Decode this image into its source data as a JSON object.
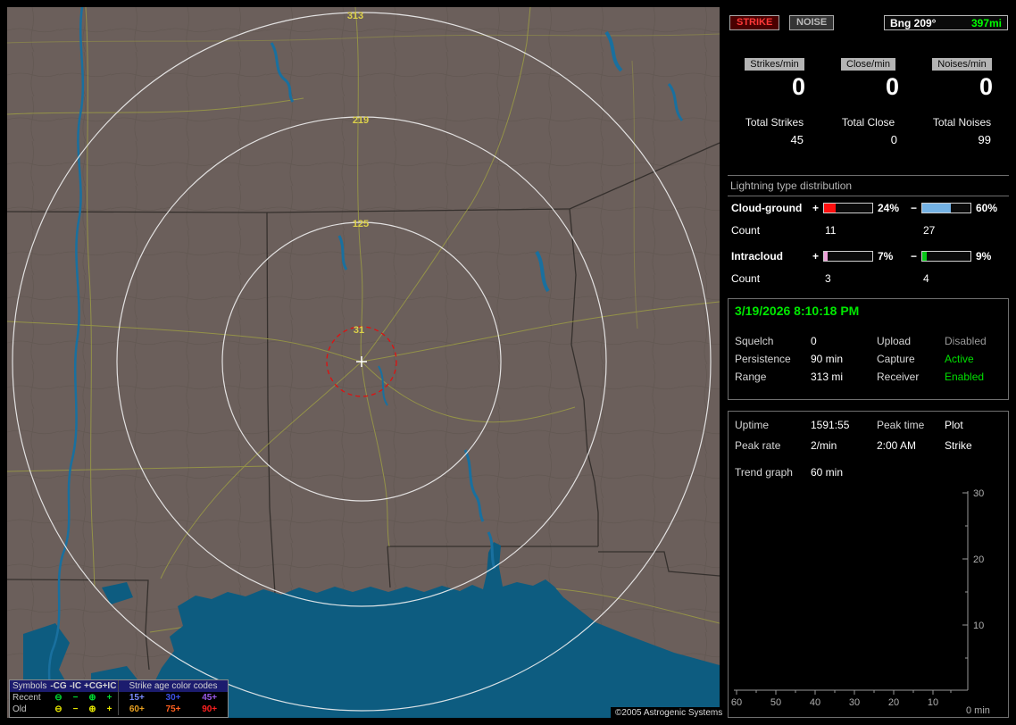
{
  "map": {
    "ring_labels": [
      "313",
      "219",
      "125",
      "31"
    ],
    "copyright": "©2005 Astrogenic Systems",
    "colors": {
      "land": "#6b5f5b",
      "water": "#0d5c80",
      "range_ring": "#f0f0f0",
      "ring_label": "#ddd24a",
      "alarm_ring": "#e01010",
      "road": "#9b9b45"
    },
    "legend": {
      "symbols_header": "Symbols",
      "type_headers": [
        "-CG",
        "-IC",
        "+CG",
        "+IC"
      ],
      "age_header": "Strike age color codes",
      "rows": [
        {
          "label": "Recent",
          "symbols": [
            "⊖",
            "−",
            "⊕",
            "+"
          ],
          "symbol_color": "#00dc32",
          "ages": [
            "15+",
            "30+",
            "45+"
          ],
          "age_colors": [
            "#7a8cff",
            "#3c50e8",
            "#9a5ae8"
          ]
        },
        {
          "label": "Old",
          "symbols": [
            "⊖",
            "−",
            "⊕",
            "+"
          ],
          "symbol_color": "#e8e800",
          "ages": [
            "60+",
            "75+",
            "90+"
          ],
          "age_colors": [
            "#e8a020",
            "#ff6020",
            "#ff2020"
          ]
        }
      ]
    }
  },
  "sidebar": {
    "header": {
      "strike": "STRIKE",
      "noise": "NOISE",
      "bearing": "Bng 209°",
      "distance": "397mi",
      "distance_color": "#00ff00"
    },
    "rates": [
      {
        "label": "Strikes/min",
        "value": "0"
      },
      {
        "label": "Close/min",
        "value": "0"
      },
      {
        "label": "Noises/min",
        "value": "0"
      }
    ],
    "totals": [
      {
        "label": "Total Strikes",
        "value": "45"
      },
      {
        "label": "Total Close",
        "value": "0"
      },
      {
        "label": "Total Noises",
        "value": "99"
      }
    ],
    "distribution": {
      "title": "Lightning type distribution",
      "rows": [
        {
          "label": "Cloud-ground",
          "plus_sign": "+",
          "plus_pct_text": "24%",
          "plus_pct": 24,
          "plus_color": "#ff1010",
          "minus_sign": "−",
          "minus_pct_text": "60%",
          "minus_pct": 60,
          "minus_color": "#74b2e4",
          "count_label": "Count",
          "plus_count": "11",
          "minus_count": "27"
        },
        {
          "label": "Intracloud",
          "plus_sign": "+",
          "plus_pct_text": "7%",
          "plus_pct": 7,
          "plus_color": "#eda0d8",
          "minus_sign": "−",
          "minus_pct_text": "9%",
          "minus_pct": 9,
          "minus_color": "#08c818",
          "count_label": "Count",
          "plus_count": "3",
          "minus_count": "4"
        }
      ]
    },
    "status": {
      "datetime": "3/19/2026 8:10:18 PM",
      "rows": [
        {
          "l1": "Squelch",
          "v1": "0",
          "l2": "Upload",
          "v2": "Disabled",
          "v2_color": "#9a9a9a"
        },
        {
          "l1": "Persistence",
          "v1": "90 min",
          "l2": "Capture",
          "v2": "Active",
          "v2_color": "#00e000"
        },
        {
          "l1": "Range",
          "v1": "313 mi",
          "l2": "Receiver",
          "v2": "Enabled",
          "v2_color": "#00e000"
        }
      ]
    },
    "stats": {
      "rows": [
        {
          "l1": "Uptime",
          "v1": "1591:55",
          "l2": "Peak time",
          "v2": "Plot"
        },
        {
          "l1": "Peak rate",
          "v1": "2/min",
          "l2": "2:00 AM",
          "v2": "Strike"
        }
      ],
      "trend_label": "Trend graph",
      "trend_value": "60 min"
    }
  },
  "chart_data": {
    "type": "line",
    "title": "Trend graph (60 min)",
    "xlabel": "min",
    "ylabel": "",
    "xlim": [
      60,
      0
    ],
    "ylim": [
      0,
      30
    ],
    "grid": false,
    "x_ticks": [
      "60",
      "50",
      "40",
      "30",
      "20",
      "10"
    ],
    "x_end_label": "0 min",
    "y_ticks": [
      "30",
      "20",
      "10"
    ],
    "series": [
      {
        "name": "Strike",
        "values": []
      }
    ]
  }
}
